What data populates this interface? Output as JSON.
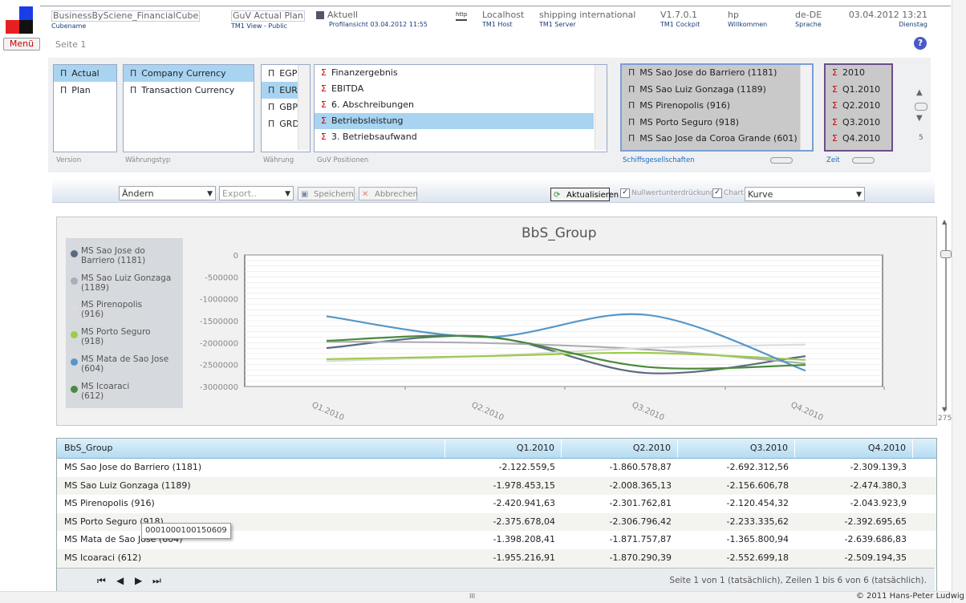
{
  "header": {
    "cube_name": "BusinessBySciene_FinancialCube",
    "cube_label": "Cubename",
    "view_name": "GuV Actual Plan",
    "view_label": "TM1 View - Public",
    "current_title": "Aktuell",
    "current_sub": "Profilansicht 03.04.2012 11:55",
    "http_label": "http",
    "host": "Localhost",
    "host_label": "TM1 Host",
    "server": "shipping international",
    "server_label": "TM1 Server",
    "version": "V1.7.0.1",
    "version_label": "TM1 Cockpit",
    "user": "hp",
    "user_label": "Willkommen",
    "language": "de-DE",
    "language_label": "Sprache",
    "datetime": "03.04.2012 13:21",
    "weekday": "Dienstag"
  },
  "menu_label": "Menü",
  "page_label": "Seite 1",
  "help_label": "?",
  "filters": {
    "version": {
      "label": "Version",
      "items": [
        {
          "text": "Actual",
          "selected": true
        },
        {
          "text": "Plan",
          "selected": false
        }
      ]
    },
    "currency_type": {
      "label": "Währungstyp",
      "items": [
        {
          "text": "Company Currency",
          "selected": true
        },
        {
          "text": "Transaction Currency",
          "selected": false
        }
      ]
    },
    "currency": {
      "label": "Währung",
      "items": [
        {
          "text": "EGP",
          "selected": false
        },
        {
          "text": "EUR",
          "selected": true
        },
        {
          "text": "GBP",
          "selected": false
        },
        {
          "text": "GRD",
          "selected": false
        }
      ]
    },
    "guv": {
      "label": "GuV Positionen",
      "items": [
        {
          "text": "Finanzergebnis",
          "selected": false
        },
        {
          "text": "EBITDA",
          "selected": false
        },
        {
          "text": "6. Abschreibungen",
          "selected": false
        },
        {
          "text": "Betriebsleistung",
          "selected": true
        },
        {
          "text": "3. Betriebsaufwand",
          "selected": false
        }
      ]
    },
    "ships": {
      "label": "Schiffsgesellschaften",
      "items": [
        "MS Sao Jose do Barriero (1181)",
        "MS Sao Luiz Gonzaga (1189)",
        "MS Pirenopolis (916)",
        "MS Porto Seguro (918)",
        "MS Sao Jose da Coroa Grande (601)"
      ]
    },
    "time": {
      "label": "Zeit",
      "items": [
        "2010",
        "Q1.2010",
        "Q2.2010",
        "Q3.2010",
        "Q4.2010"
      ]
    },
    "side_number": "5"
  },
  "toolbar": {
    "action_select": "Ändern",
    "export_select": "Export..",
    "save_label": "Speichern",
    "cancel_label": "Abbrechen",
    "refresh_label": "Aktualisieren",
    "zero_suppress_label": "Nullwertunterdrückung",
    "chart_label": "Chart",
    "chart_type": "Kurve"
  },
  "chart_data": {
    "type": "line",
    "title": "BbS_Group",
    "categories": [
      "Q1.2010",
      "Q2.2010",
      "Q3.2010",
      "Q4.2010"
    ],
    "yticks": [
      "0",
      "-500000",
      "-1000000",
      "-1500000",
      "-2000000",
      "-2500000",
      "-3000000"
    ],
    "ylim": [
      -3000000,
      0
    ],
    "series": [
      {
        "name": "MS Sao Jose do\nBarriero (1181)",
        "color": "#5a6a80",
        "values": [
          -2122559.5,
          -1860578.87,
          -2692312.56,
          -2309139.3
        ]
      },
      {
        "name": "MS Sao Luiz Gonzaga\n(1189)",
        "color": "#a9adb5",
        "values": [
          -1978453.15,
          -2008365.13,
          -2156606.78,
          -2474380.3
        ]
      },
      {
        "name": "MS Pirenopolis\n(916)",
        "color": "#dcdcdc",
        "values": [
          -2420941.63,
          -2301762.81,
          -2120454.32,
          -2043923.9
        ]
      },
      {
        "name": "MS Porto Seguro\n(918)",
        "color": "#9ccc4a",
        "values": [
          -2375678.04,
          -2306796.42,
          -2233335.62,
          -2392695.65
        ]
      },
      {
        "name": "MS Mata de Sao Jose\n(604)",
        "color": "#5696c8",
        "values": [
          -1398208.41,
          -1871757.87,
          -1365800.94,
          -2639686.83
        ]
      },
      {
        "name": "MS Icoaraci\n(612)",
        "color": "#4a8a3a",
        "values": [
          -1955216.91,
          -1870290.39,
          -2552699.18,
          -2509194.35
        ]
      }
    ],
    "grid": true,
    "legend": "left"
  },
  "table": {
    "headers": [
      "BbS_Group",
      "Q1.2010",
      "Q2.2010",
      "Q3.2010",
      "Q4.2010"
    ],
    "rows": [
      [
        "MS Sao Jose do Barriero (1181)",
        "-2.122.559,5",
        "-1.860.578,87",
        "-2.692.312,56",
        "-2.309.139,3"
      ],
      [
        "MS Sao Luiz Gonzaga (1189)",
        "-1.978.453,15",
        "-2.008.365,13",
        "-2.156.606,78",
        "-2.474.380,3"
      ],
      [
        "MS Pirenopolis (916)",
        "-2.420.941,63",
        "-2.301.762,81",
        "-2.120.454,32",
        "-2.043.923,9"
      ],
      [
        "MS Porto Seguro (918)",
        "-2.375.678,04",
        "-2.306.796,42",
        "-2.233.335,62",
        "-2.392.695,65"
      ],
      [
        "MS Mata de Sao Jose (604)",
        "-1.398.208,41",
        "-1.871.757,87",
        "-1.365.800,94",
        "-2.639.686,83"
      ],
      [
        "MS Icoaraci (612)",
        "-1.955.216,91",
        "-1.870.290,39",
        "-2.552.699,18",
        "-2.509.194,35"
      ]
    ],
    "tooltip": "0001000100150609",
    "pager_text": "Seite 1 von 1 (tatsächlich), Zeilen 1 bis 6 von 6 (tatsächlich)."
  },
  "scroll_label": "275",
  "bottom_scroll_label": "III",
  "copyright": "© 2011 Hans-Peter Ludwig"
}
